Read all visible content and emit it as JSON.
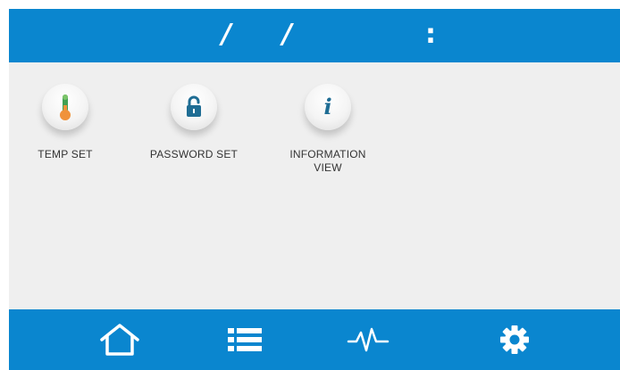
{
  "header": {
    "date_separator_1": "/",
    "date_separator_2": "/",
    "time_separator": ":"
  },
  "apps": [
    {
      "label": "TEMP SET",
      "icon": "thermometer-icon"
    },
    {
      "label": "PASSWORD SET",
      "icon": "lock-icon"
    },
    {
      "label_line1": "INFORMATION",
      "label_line2": "VIEW",
      "icon": "info-icon",
      "glyph": "i"
    }
  ],
  "nav": {
    "items": [
      "home-icon",
      "list-icon",
      "pulse-icon",
      "gear-icon"
    ]
  },
  "colors": {
    "bar": "#0a86cf",
    "background": "#efefef",
    "icon_blue": "#1f6d94",
    "thermo_orange": "#f0923a",
    "thermo_green": "#3fa052"
  }
}
